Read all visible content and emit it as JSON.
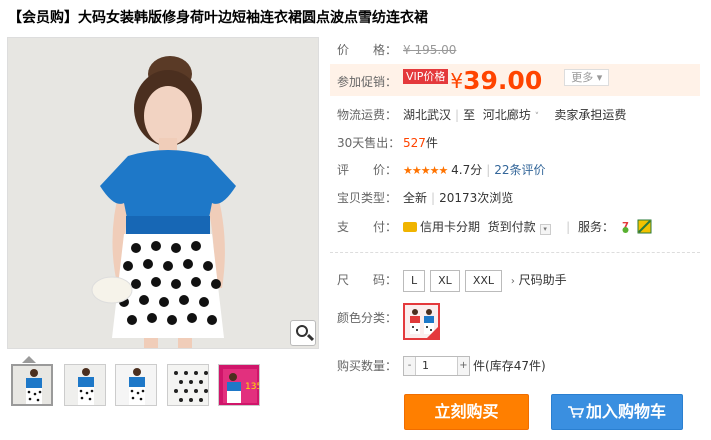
{
  "product": {
    "title": "【会员购】大码女装韩版修身荷叶边短袖连衣裙圆点波点雪纺连衣裙"
  },
  "price": {
    "label": "价　　格：",
    "original": "¥ 195.00"
  },
  "promo": {
    "label": "参加促销：",
    "tag": "VIP价格",
    "currency": "¥",
    "value": "39.00",
    "more": "更多 ▾"
  },
  "shipping": {
    "label": "物流运费：",
    "from": "湖北武汉",
    "to_prefix": "至",
    "to": "河北廊坊",
    "dropdown_arrow": "˅",
    "fee": "卖家承担运费"
  },
  "sales": {
    "label": "30天售出：",
    "count": "527",
    "unit": "件"
  },
  "rating": {
    "label": "评　　价：",
    "stars": "★★★★★",
    "score": "4.7分",
    "reviews": "22条评价"
  },
  "type": {
    "label": "宝贝类型：",
    "condition": "全新",
    "views": "20173次浏览"
  },
  "payment": {
    "label": "支　　付：",
    "installment": "信用卡分期",
    "cod": "货到付款",
    "service_label": "服务："
  },
  "size": {
    "label": "尺　　码：",
    "options": [
      "L",
      "XL",
      "XXL"
    ],
    "helper": "尺码助手"
  },
  "color": {
    "label": "颜色分类："
  },
  "quantity": {
    "label": "购买数量：",
    "value": "1",
    "minus": "-",
    "plus": "+",
    "unit": "件",
    "stock": "(库存47件)"
  },
  "actions": {
    "buy_now": "立刻购买",
    "add_cart": "加入购物车"
  },
  "thumbnail": {
    "badge": "135"
  },
  "colors": {
    "price": "#ff4400",
    "buy_button": "#ff7f00",
    "cart_button": "#3a8fe0",
    "dress_blue": "#1e78c8"
  },
  "icons": [
    "zoom-icon",
    "credit-card-icon",
    "service-seven-day-icon",
    "service-guarantee-icon",
    "cart-icon",
    "chevron-right-icon"
  ]
}
